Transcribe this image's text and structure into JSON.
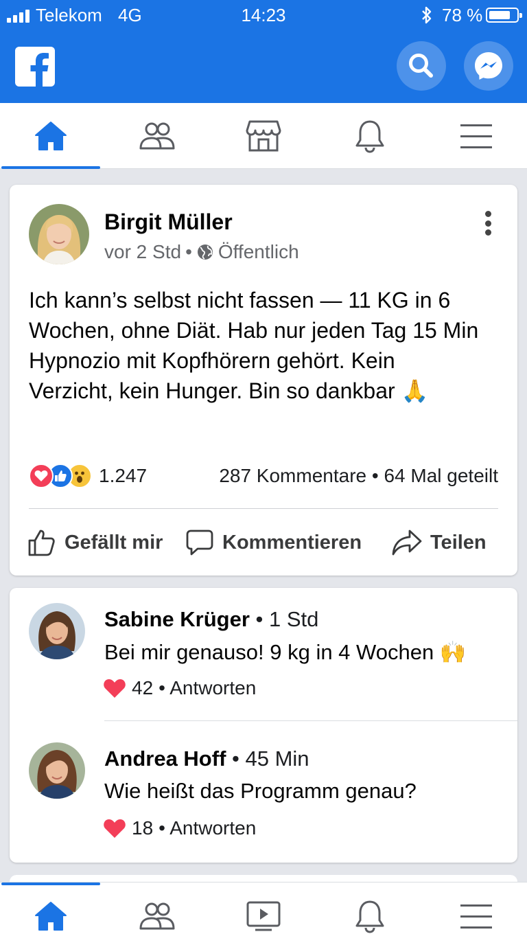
{
  "status_bar": {
    "carrier": "Telekom",
    "network": "4G",
    "time": "14:23",
    "battery_text": "78 %",
    "battery_level": 0.78
  },
  "app_bar": {
    "logo_icon": "facebook-logo",
    "search_icon": "search-icon",
    "messenger_icon": "messenger-icon"
  },
  "top_tabs": [
    {
      "icon": "home-icon",
      "active": true
    },
    {
      "icon": "friends-icon",
      "active": false
    },
    {
      "icon": "marketplace-icon",
      "active": false
    },
    {
      "icon": "bell-icon",
      "active": false
    },
    {
      "icon": "menu-icon",
      "active": false
    }
  ],
  "post": {
    "author": "Birgit Müller",
    "time": "vor 2 Std",
    "separator": "•",
    "audience": "Öffentlich",
    "text_lines": [
      "Ich kann’s selbst nicht fassen — 11 KG in 6",
      "Wochen, ohne Diät. Hab nur jeden Tag 15 Min",
      "Hypnozio mit Kopfhörern gehört. Kein",
      "Verzicht, kein Hunger. Bin so dankbar 🙏"
    ],
    "reaction_count": "1.247",
    "stats": "287 Kommentare • 64 Mal geteilt",
    "actions": {
      "like": "Gefällt mir",
      "comment": "Kommentieren",
      "share": "Teilen"
    }
  },
  "comments": [
    {
      "name": "Sabine Krüger",
      "time": " • 1 Std",
      "text": "Bei mir genauso! 9 kg in 4 Wochen 🙌",
      "likes": "42",
      "reply": "• Antworten"
    },
    {
      "name": "Andrea Hoff",
      "time": " • 45 Min",
      "text": "Wie heißt das Programm genau?",
      "likes": "18",
      "reply": "• Antworten"
    }
  ],
  "bottom_nav": [
    {
      "icon": "home-icon",
      "active": true
    },
    {
      "icon": "friends-icon",
      "active": false
    },
    {
      "icon": "video-icon",
      "active": false
    },
    {
      "icon": "bell-icon",
      "active": false
    },
    {
      "icon": "menu-icon",
      "active": false
    }
  ],
  "colors": {
    "brand_blue": "#1b74e4",
    "love_red": "#f33e58",
    "secondary_text": "#65676b"
  }
}
